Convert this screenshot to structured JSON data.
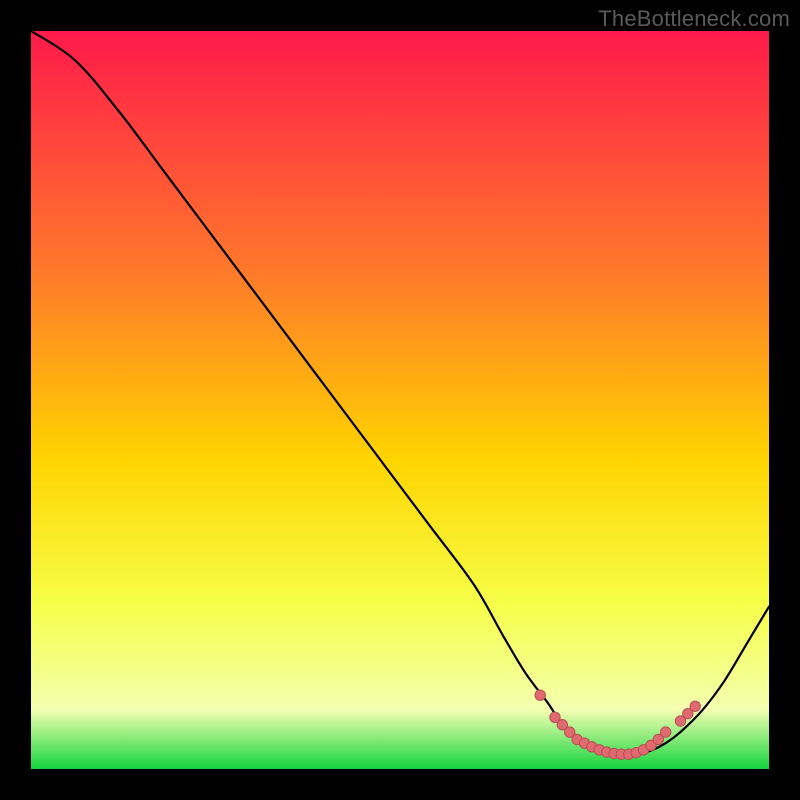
{
  "watermark": "TheBottleneck.com",
  "colors": {
    "grad_top": "#ff1a4b",
    "grad_upper_mid": "#ff7a2a",
    "grad_mid": "#ffd400",
    "grad_lower_mid": "#f6ff4a",
    "grad_pale": "#f3ffb0",
    "grad_green": "#13d43e",
    "line": "#000000",
    "marker_fill": "#e06a6f",
    "marker_stroke": "#b84e55"
  },
  "chart_data": {
    "type": "line",
    "title": "",
    "xlabel": "",
    "ylabel": "",
    "xlim": [
      0,
      100
    ],
    "ylim": [
      0,
      100
    ],
    "series": [
      {
        "name": "curve",
        "x": [
          0,
          6,
          12,
          18,
          24,
          30,
          36,
          42,
          48,
          54,
          60,
          64,
          67,
          70,
          72,
          74,
          76,
          78,
          80,
          82,
          84,
          86,
          88,
          91,
          94,
          97,
          100
        ],
        "y": [
          100,
          96,
          89,
          81,
          73,
          65,
          57,
          49,
          41,
          33,
          25,
          18,
          13,
          9,
          6,
          4,
          3,
          2.2,
          2,
          2,
          2.5,
          3.5,
          5,
          8,
          12,
          17,
          22
        ]
      }
    ],
    "markers": {
      "name": "highlight",
      "x": [
        69,
        71,
        72,
        73,
        74,
        75,
        76,
        77,
        78,
        79,
        80,
        81,
        82,
        83,
        84,
        85,
        86,
        88,
        89,
        90
      ],
      "y": [
        10,
        7,
        6,
        5,
        4,
        3.5,
        3,
        2.6,
        2.3,
        2.1,
        2,
        2,
        2.2,
        2.6,
        3.2,
        4,
        5,
        6.5,
        7.5,
        8.5
      ]
    }
  }
}
